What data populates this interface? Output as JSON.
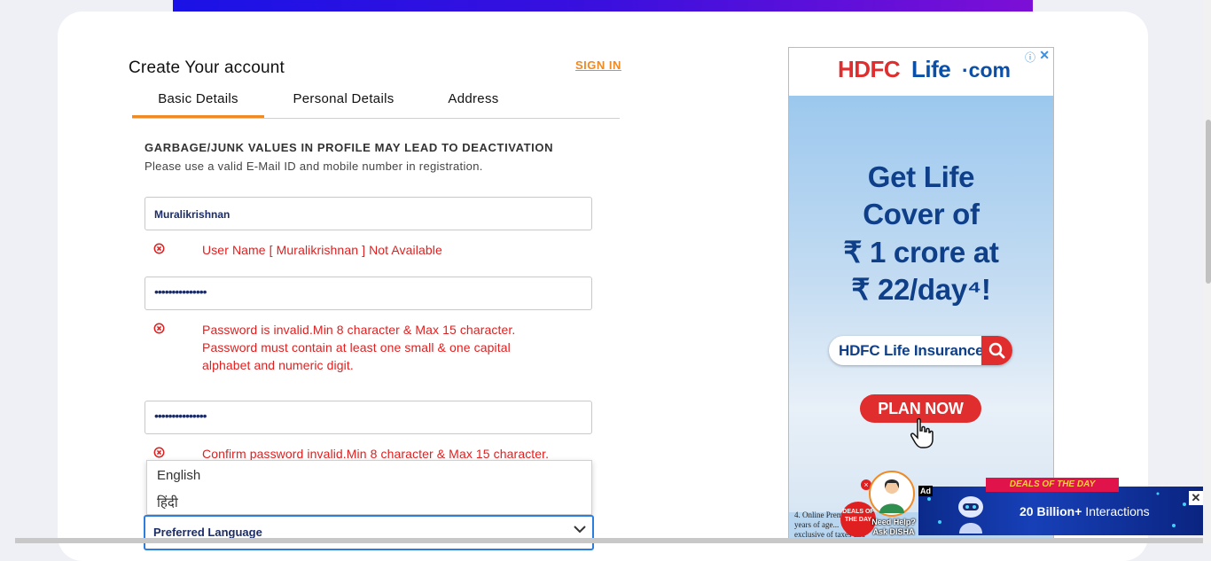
{
  "form": {
    "title": "Create Your account",
    "signin": "SIGN IN",
    "tabs": [
      "Basic Details",
      "Personal Details",
      "Address"
    ],
    "warning_heading": "GARBAGE/JUNK VALUES IN PROFILE MAY LEAD TO DEACTIVATION",
    "warning_sub": "Please use a valid E-Mail ID and mobile number in registration.",
    "username_value": "Muralikrishnan",
    "username_error": "User Name [ Muralikrishnan ] Not Available",
    "password_mask": "•••••••••••••••",
    "password_error_lines": [
      "Password is invalid.Min 8 character & Max 15 character.",
      "Password must contain at least one small & one capital",
      "alphabet and numeric digit."
    ],
    "confirm_mask": "•••••••••••••••",
    "confirm_error": "Confirm password invalid.Min 8 character & Max 15 character.",
    "language_options": [
      "English",
      "हिंदी"
    ],
    "language_select": "Preferred Language"
  },
  "ad": {
    "brand_a": "HDFC",
    "brand_b": "Life",
    "brand_c": "·com",
    "info_icon": "ⓘ",
    "close_icon": "✕",
    "headline": [
      "Get Life",
      "Cover of",
      "₹ 1 crore at",
      "₹ 22/day⁴!"
    ],
    "search_text": "HDFC Life Insurance",
    "cta": "PLAN NOW",
    "fine_print": "4. Online Prem... 25 years of age... exclusive of taxes and l..."
  },
  "widgets": {
    "close_x": "×",
    "deal_badge": "DEALS OF THE DAY",
    "disha": "Need Help? Ask DISHA",
    "ad_tag": "Ad",
    "deals_title": "DEALS OF THE DAY",
    "banner_text_bold": "20 Billion+",
    "banner_text": " Interactions",
    "banner_close": "✕"
  },
  "colors": {
    "accent": "#f08a24",
    "error": "#e02020",
    "brand_red": "#e02d2d",
    "brand_blue": "#0a4fa8",
    "select_border": "#2b7de0"
  }
}
